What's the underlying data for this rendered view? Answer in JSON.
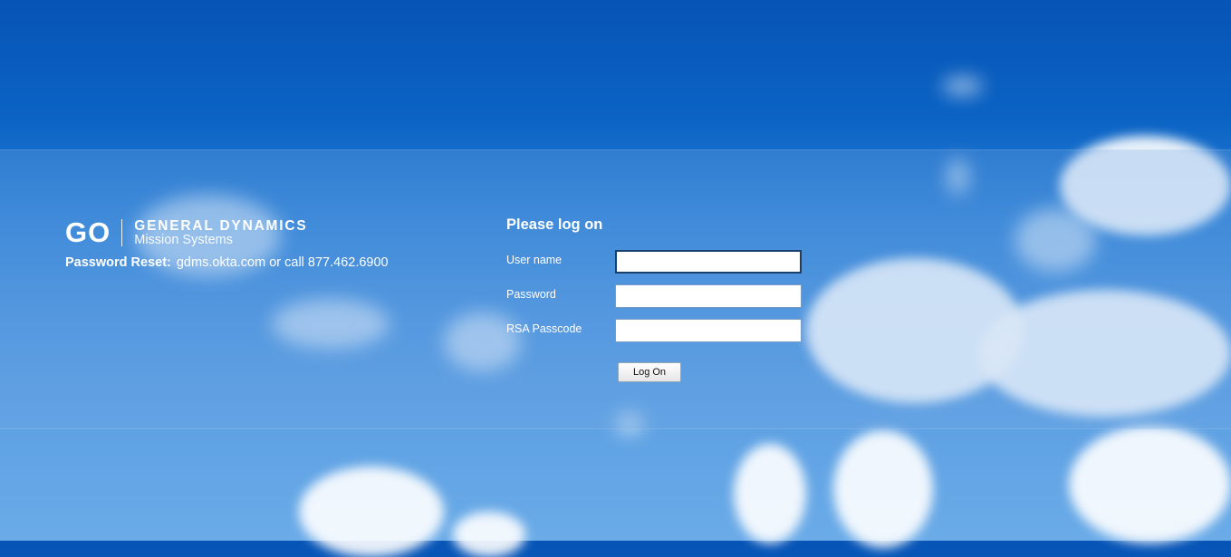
{
  "brand": {
    "logo_mark": "GO",
    "company": "GENERAL DYNAMICS",
    "division": "Mission Systems"
  },
  "password_reset": {
    "label": "Password Reset:",
    "text": "gdms.okta.com or call 877.462.6900"
  },
  "login": {
    "title": "Please log on",
    "username_label": "User name",
    "username_value": "",
    "password_label": "Password",
    "password_value": "",
    "rsa_label": "RSA Passcode",
    "rsa_value": "",
    "submit_label": "Log On"
  }
}
